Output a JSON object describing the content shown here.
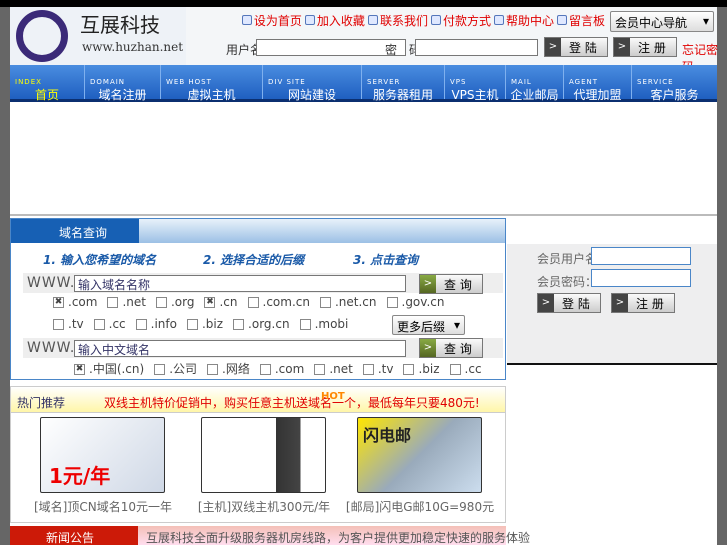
{
  "header": {
    "logo_title": "互展科技",
    "logo_url": "www.huzhan.net",
    "top_links": [
      "设为首页",
      "加入收藏",
      "联系我们",
      "付款方式",
      "帮助中心",
      "留言板"
    ],
    "site_select": "会员中心导航",
    "username_label": "用户名:",
    "password_label": "密　码:",
    "login": "登 陆",
    "register": "注 册",
    "forgot": "忘记密码"
  },
  "nav": [
    {
      "en": "INDEX",
      "cn": "首页"
    },
    {
      "en": "DOMAIN",
      "cn": "域名注册"
    },
    {
      "en": "WEB HOST",
      "cn": "虚拟主机"
    },
    {
      "en": "DIV SITE",
      "cn": "网站建设"
    },
    {
      "en": "SERVER",
      "cn": "服务器租用"
    },
    {
      "en": "VPS",
      "cn": "VPS主机"
    },
    {
      "en": "MAIL",
      "cn": "企业邮局"
    },
    {
      "en": "AGENT",
      "cn": "代理加盟"
    },
    {
      "en": "SERVICE",
      "cn": "客户服务"
    }
  ],
  "domain": {
    "title": "域名查询",
    "steps": [
      "1. 输入您希望的域名",
      "2. 选择合适的后缀",
      "3. 点击查询"
    ],
    "prefix": "WWW.",
    "input1": "输入域名名称",
    "search": "查 询",
    "tlds1": [
      {
        "t": ".com",
        "c": true
      },
      {
        "t": ".net",
        "c": false
      },
      {
        "t": ".org",
        "c": false
      },
      {
        "t": ".cn",
        "c": true
      },
      {
        "t": ".com.cn",
        "c": false
      },
      {
        "t": ".net.cn",
        "c": false
      },
      {
        "t": ".gov.cn",
        "c": false
      }
    ],
    "tlds2": [
      {
        "t": ".tv",
        "c": false
      },
      {
        "t": ".cc",
        "c": false
      },
      {
        "t": ".info",
        "c": false
      },
      {
        "t": ".biz",
        "c": false
      },
      {
        "t": ".org.cn",
        "c": false
      },
      {
        "t": ".mobi",
        "c": false
      }
    ],
    "more_select": "更多后缀",
    "input2": "输入中文域名",
    "tlds3": [
      {
        "t": ".中国(.cn)",
        "c": true
      },
      {
        "t": ".公司",
        "c": false
      },
      {
        "t": ".网络",
        "c": false
      },
      {
        "t": ".com",
        "c": false
      },
      {
        "t": ".net",
        "c": false
      },
      {
        "t": ".tv",
        "c": false
      },
      {
        "t": ".biz",
        "c": false
      },
      {
        "t": ".cc",
        "c": false
      }
    ]
  },
  "login_panel": {
    "user_label": "会员用户名",
    "pass_label": "会员密码：",
    "login": "登 陆",
    "register": "注 册"
  },
  "promo": {
    "title": "热门推荐",
    "headline": "双线主机特价促销中，购买任意主机送域名一个，最低每年只要480元!",
    "hot": "HOT",
    "items": [
      {
        "caption": "[域名]顶CN域名10元一年",
        "img": "1元/年"
      },
      {
        "caption": "[主机]双线主机300元/年",
        "img": ""
      },
      {
        "caption": "[邮局]闪电G邮10G=980元",
        "img": "闪电邮"
      }
    ]
  },
  "news": {
    "title": "新闻公告",
    "text": "互展科技全面升级服务器机房线路，为客户提供更加稳定快速的服务体验"
  }
}
